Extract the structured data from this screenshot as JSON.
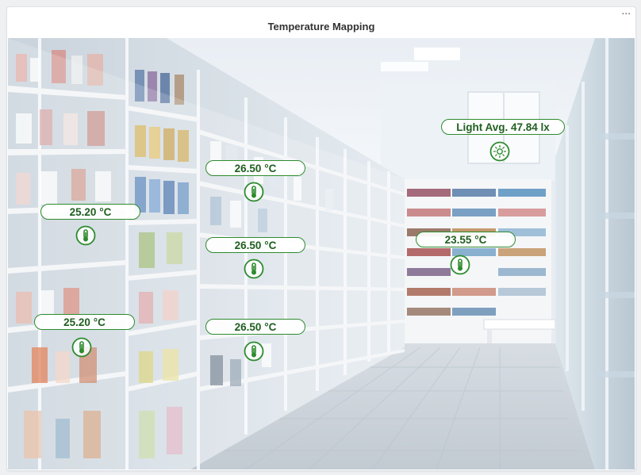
{
  "widget": {
    "title": "Temperature Mapping",
    "menu_label": "..."
  },
  "colors": {
    "accent_green": "#2e8b2e",
    "label_text": "#1f5f1f"
  },
  "sensors": [
    {
      "type": "temperature",
      "icon": "thermometer-icon",
      "value": "25.20 °C"
    },
    {
      "type": "temperature",
      "icon": "thermometer-icon",
      "value": "25.20 °C"
    },
    {
      "type": "temperature",
      "icon": "thermometer-icon",
      "value": "26.50 °C"
    },
    {
      "type": "temperature",
      "icon": "thermometer-icon",
      "value": "26.50 °C"
    },
    {
      "type": "temperature",
      "icon": "thermometer-icon",
      "value": "26.50 °C"
    },
    {
      "type": "temperature",
      "icon": "thermometer-icon",
      "value": "23.55 °C"
    },
    {
      "type": "light",
      "icon": "sun-icon",
      "value": "Light Avg. 47.84 lx"
    }
  ]
}
